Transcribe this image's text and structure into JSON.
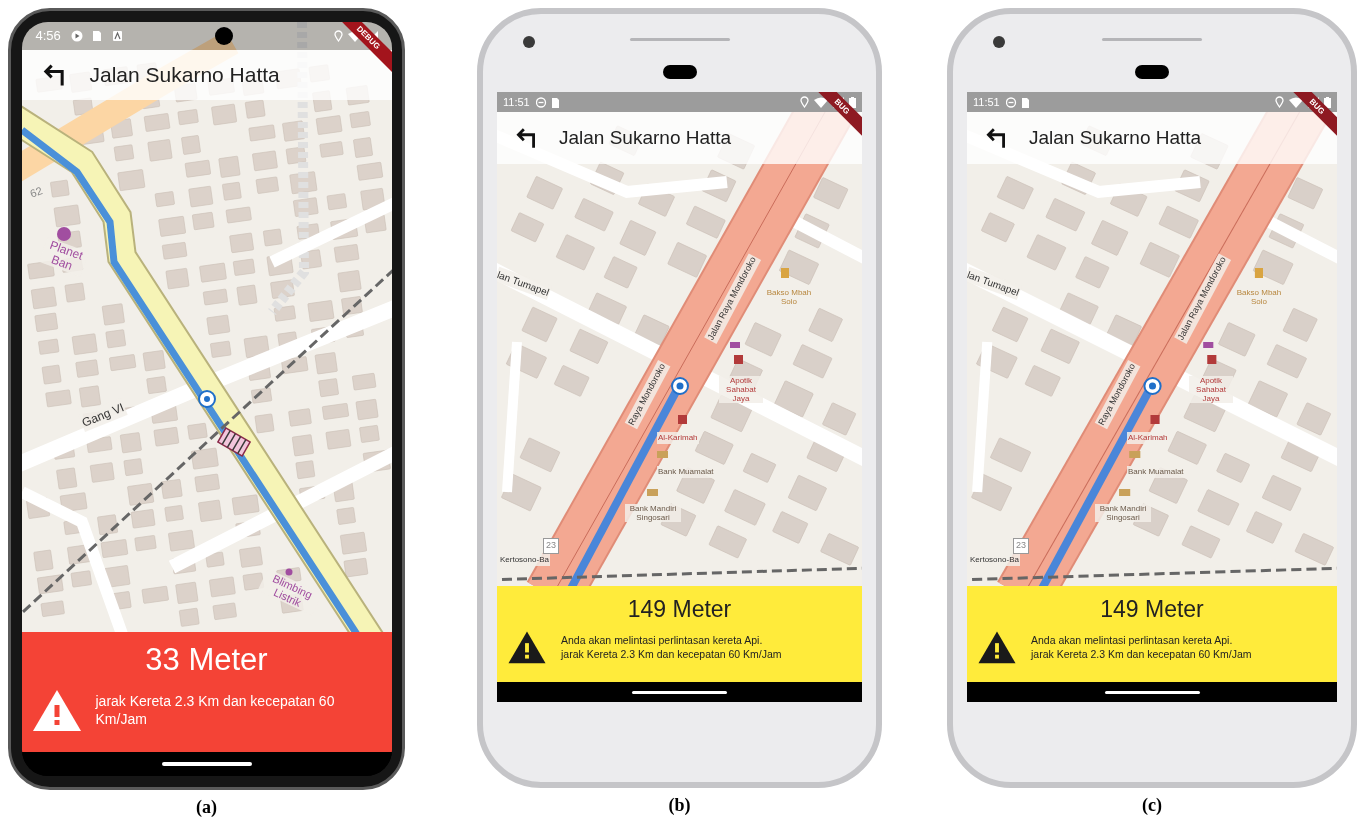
{
  "panels": [
    {
      "caption": "(a)",
      "kind": "dark",
      "status_bar": {
        "time": "4:56"
      },
      "debug_banner": "DEBUG",
      "title": "Jalan Sukarno Hatta",
      "map": {
        "kind": "city_grid",
        "labels": [
          {
            "text": "62",
            "kind": "ref"
          },
          {
            "text": "Planet Ban",
            "kind": "shop"
          },
          {
            "text": "Gang VI",
            "kind": "street"
          },
          {
            "text": "Blimbing Listrik",
            "kind": "shop"
          }
        ]
      },
      "alert": {
        "kind": "danger",
        "distance": "33 Meter",
        "lines": [
          "jarak Kereta 2.3 Km dan kecepatan 60 Km/Jam"
        ]
      }
    },
    {
      "caption": "(b)",
      "kind": "silver",
      "status_bar": {
        "time": "11:51"
      },
      "debug_banner": "BUG",
      "title": "Jalan Sukarno Hatta",
      "map": {
        "kind": "main_road",
        "labels": [
          {
            "text": "lan Tumapel",
            "kind": "street"
          },
          {
            "text": "Jalan Raya Mondoroko",
            "kind": "street"
          },
          {
            "text": "Raya Mondoroko",
            "kind": "street"
          },
          {
            "text": "Bakso Mbah Solo",
            "kind": "food"
          },
          {
            "text": "Apotik Sahabat Jaya",
            "kind": "health"
          },
          {
            "text": "Al-Karimah",
            "kind": "health"
          },
          {
            "text": "Bank Muamalat",
            "kind": "bank"
          },
          {
            "text": "Bank Mandiri Singosari",
            "kind": "bank"
          },
          {
            "text": "23",
            "kind": "ref"
          },
          {
            "text": "Kertosono-Ba",
            "kind": "street"
          }
        ]
      },
      "alert": {
        "kind": "warning",
        "distance": "149 Meter",
        "lines": [
          "Anda akan melintasi perlintasan kereta Api.",
          "jarak Kereta 2.3 Km dan kecepatan 60 Km/Jam"
        ]
      }
    },
    {
      "caption": "(c)",
      "kind": "silver",
      "status_bar": {
        "time": "11:51"
      },
      "debug_banner": "BUG",
      "title": "Jalan Sukarno Hatta",
      "map": {
        "kind": "main_road",
        "labels": [
          {
            "text": "lan Tumapel",
            "kind": "street"
          },
          {
            "text": "Jalan Raya Mondoroko",
            "kind": "street"
          },
          {
            "text": "Raya Mondoroko",
            "kind": "street"
          },
          {
            "text": "Bakso Mbah Solo",
            "kind": "food"
          },
          {
            "text": "Apotik Sahabat Jaya",
            "kind": "health"
          },
          {
            "text": "Al-Karimah",
            "kind": "health"
          },
          {
            "text": "Bank Muamalat",
            "kind": "bank"
          },
          {
            "text": "Bank Mandiri Singosari",
            "kind": "bank"
          },
          {
            "text": "23",
            "kind": "ref"
          },
          {
            "text": "Kertosono-Ba",
            "kind": "street"
          }
        ]
      },
      "alert": {
        "kind": "warning",
        "distance": "149 Meter",
        "lines": [
          "Anda akan melintasi perlintasan kereta Api.",
          "jarak Kereta 2.3 Km dan kecepatan 60 Km/Jam"
        ]
      }
    }
  ]
}
